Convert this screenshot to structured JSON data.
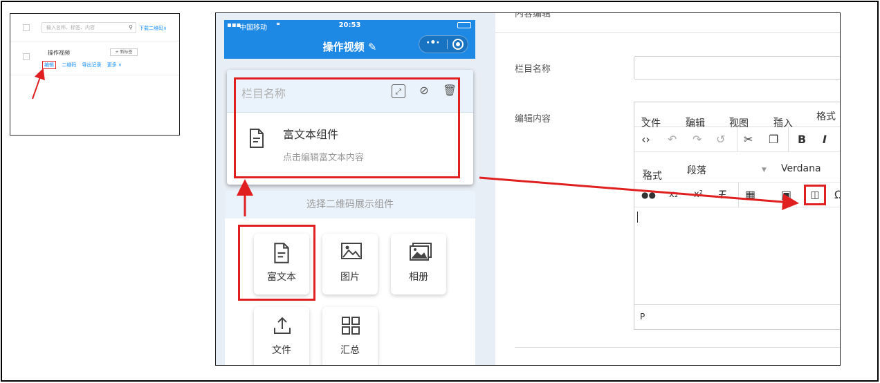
{
  "left_panel": {
    "search_placeholder": "输入名称、标签、内容",
    "download_label": "下载二维码∨",
    "row_title": "操作视频",
    "add_tag_label": "+ 新标签",
    "links": {
      "edit": "编辑",
      "qrcode": "二维码",
      "export": "导出记录",
      "more": "更多 ∨"
    }
  },
  "phone": {
    "carrier": "中国移动",
    "time": "20:53",
    "nav_title": "操作视频 ✎",
    "card": {
      "head_title": "栏目名称",
      "component_title": "富文本组件",
      "component_sub": "点击编辑富文本内容"
    },
    "chooser": {
      "title": "选择二维码展示组件",
      "items": [
        "富文本",
        "图片",
        "相册",
        "文件",
        "汇总"
      ]
    }
  },
  "form": {
    "top_label": "内容编辑",
    "column_name_label": "栏目名称",
    "edit_content_label": "编辑内容",
    "editor": {
      "menus": [
        "文件",
        "编辑",
        "视图",
        "插入",
        "格式"
      ],
      "format_label": "格式",
      "paragraph_label": "段落",
      "font_label": "Verdana",
      "status_path": "P"
    }
  },
  "colors": {
    "accent": "#1e88e5",
    "highlight": "#e02020",
    "link": "#1890ff"
  }
}
